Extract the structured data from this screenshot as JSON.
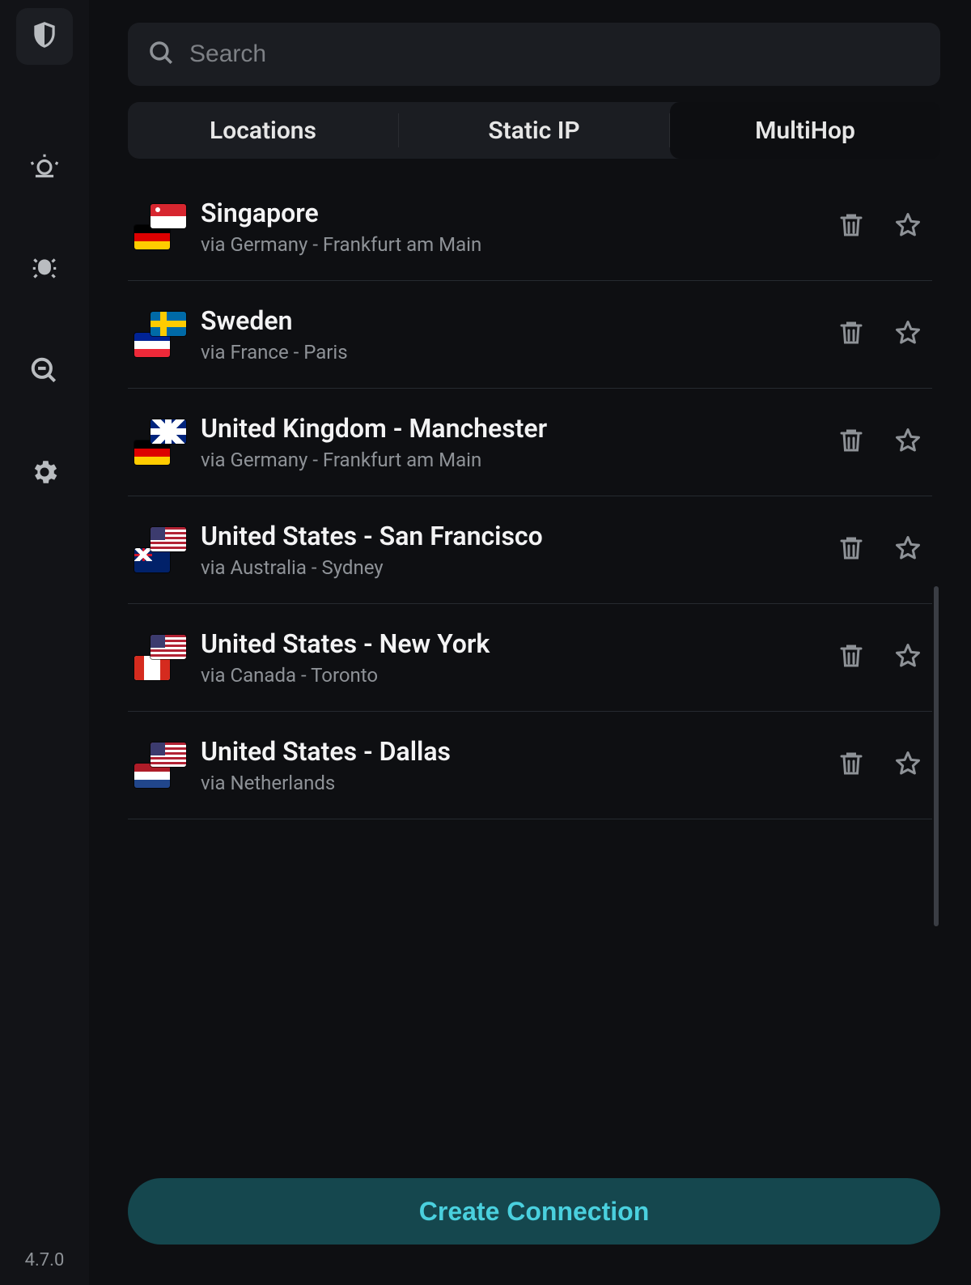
{
  "app": {
    "version": "4.7.0"
  },
  "search": {
    "placeholder": "Search",
    "value": ""
  },
  "tabs": [
    {
      "id": "locations",
      "label": "Locations",
      "active": false
    },
    {
      "id": "static-ip",
      "label": "Static IP",
      "active": false
    },
    {
      "id": "multihop",
      "label": "MultiHop",
      "active": true
    }
  ],
  "connections": [
    {
      "title": "Singapore",
      "subtitle": "via Germany - Frankfurt am Main",
      "exit_flag": "sg",
      "entry_flag": "de"
    },
    {
      "title": "Sweden",
      "subtitle": "via France - Paris",
      "exit_flag": "se",
      "entry_flag": "fr"
    },
    {
      "title": "United Kingdom - Manchester",
      "subtitle": "via Germany - Frankfurt am Main",
      "exit_flag": "gb",
      "entry_flag": "de"
    },
    {
      "title": "United States - San Francisco",
      "subtitle": "via Australia - Sydney",
      "exit_flag": "us",
      "entry_flag": "au"
    },
    {
      "title": "United States - New York",
      "subtitle": "via Canada - Toronto",
      "exit_flag": "us",
      "entry_flag": "ca"
    },
    {
      "title": "United States - Dallas",
      "subtitle": "via Netherlands",
      "exit_flag": "us",
      "entry_flag": "nl"
    }
  ],
  "cta": {
    "label": "Create Connection"
  },
  "sidebar": {
    "items": [
      {
        "id": "shield",
        "name": "shield-icon"
      },
      {
        "id": "alert",
        "name": "alert-icon"
      },
      {
        "id": "bug",
        "name": "bug-icon"
      },
      {
        "id": "search",
        "name": "zoom-icon"
      },
      {
        "id": "settings",
        "name": "gear-icon"
      }
    ]
  }
}
